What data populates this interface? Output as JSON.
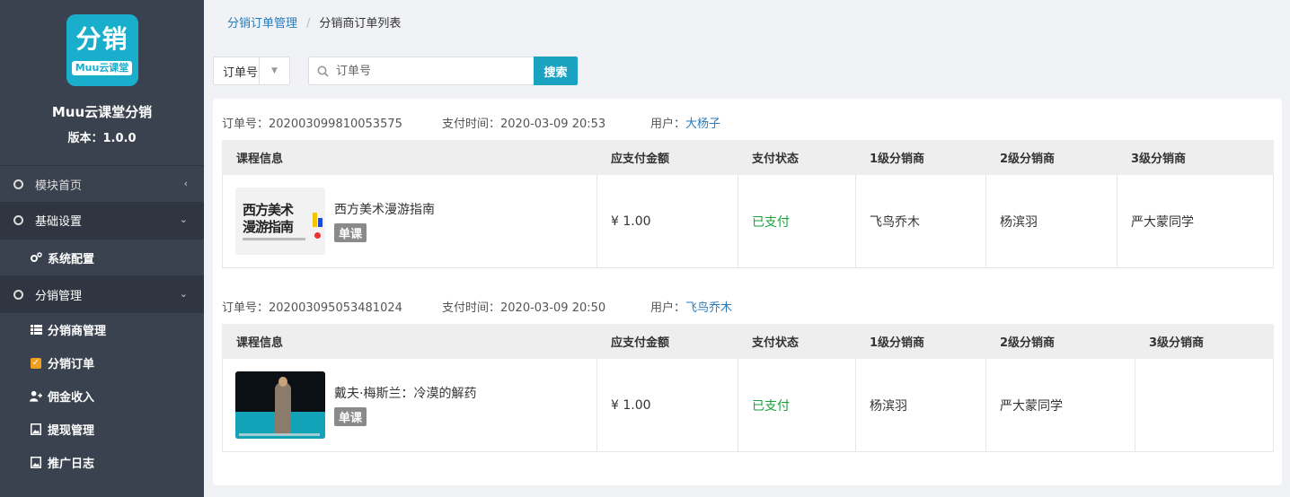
{
  "sidebar": {
    "logo_big": "分销",
    "logo_small": "Muu云课堂",
    "app_name": "Muu云课堂分销",
    "version": "版本：1.0.0",
    "menu": {
      "home": "模块首页",
      "basic": "基础设置",
      "system": "系统配置",
      "dist": "分销管理",
      "dist_items": [
        "分销商管理",
        "分销订单",
        "佣金收入",
        "提现管理",
        "推广日志"
      ]
    }
  },
  "breadcrumb": {
    "parent": "分销订单管理",
    "sep": "/",
    "current": "分销商订单列表"
  },
  "filter": {
    "field": "订单号",
    "placeholder": "订单号",
    "search_label": "搜索"
  },
  "labels": {
    "order_no": "订单号：",
    "pay_time": "支付时间：",
    "user": "用户：",
    "headers": [
      "课程信息",
      "应支付金额",
      "支付状态",
      "1级分销商",
      "2级分销商",
      "3级分销商"
    ]
  },
  "orders": [
    {
      "order_no": "202003099810053575",
      "pay_time": "2020-03-09 20:53",
      "user": "大杨子",
      "course_title": "西方美术漫游指南",
      "thumb_text": "西方美术\n漫游指南",
      "tag": "单课",
      "amount": "¥ 1.00",
      "status": "已支付",
      "level1": "飞鸟乔木",
      "level2": "杨滨羽",
      "level3": "严大蒙同学"
    },
    {
      "order_no": "202003095053481024",
      "pay_time": "2020-03-09 20:50",
      "user": "飞鸟乔木",
      "course_title": "戴夫·梅斯兰：冷漠的解药",
      "tag": "单课",
      "amount": "¥ 1.00",
      "status": "已支付",
      "level1": "杨滨羽",
      "level2": "严大蒙同学",
      "level3": ""
    }
  ],
  "colors": {
    "accent": "#19a3c1",
    "sidebar": "#3a4250",
    "paid": "#1aa03a",
    "link": "#2a7ab9"
  }
}
